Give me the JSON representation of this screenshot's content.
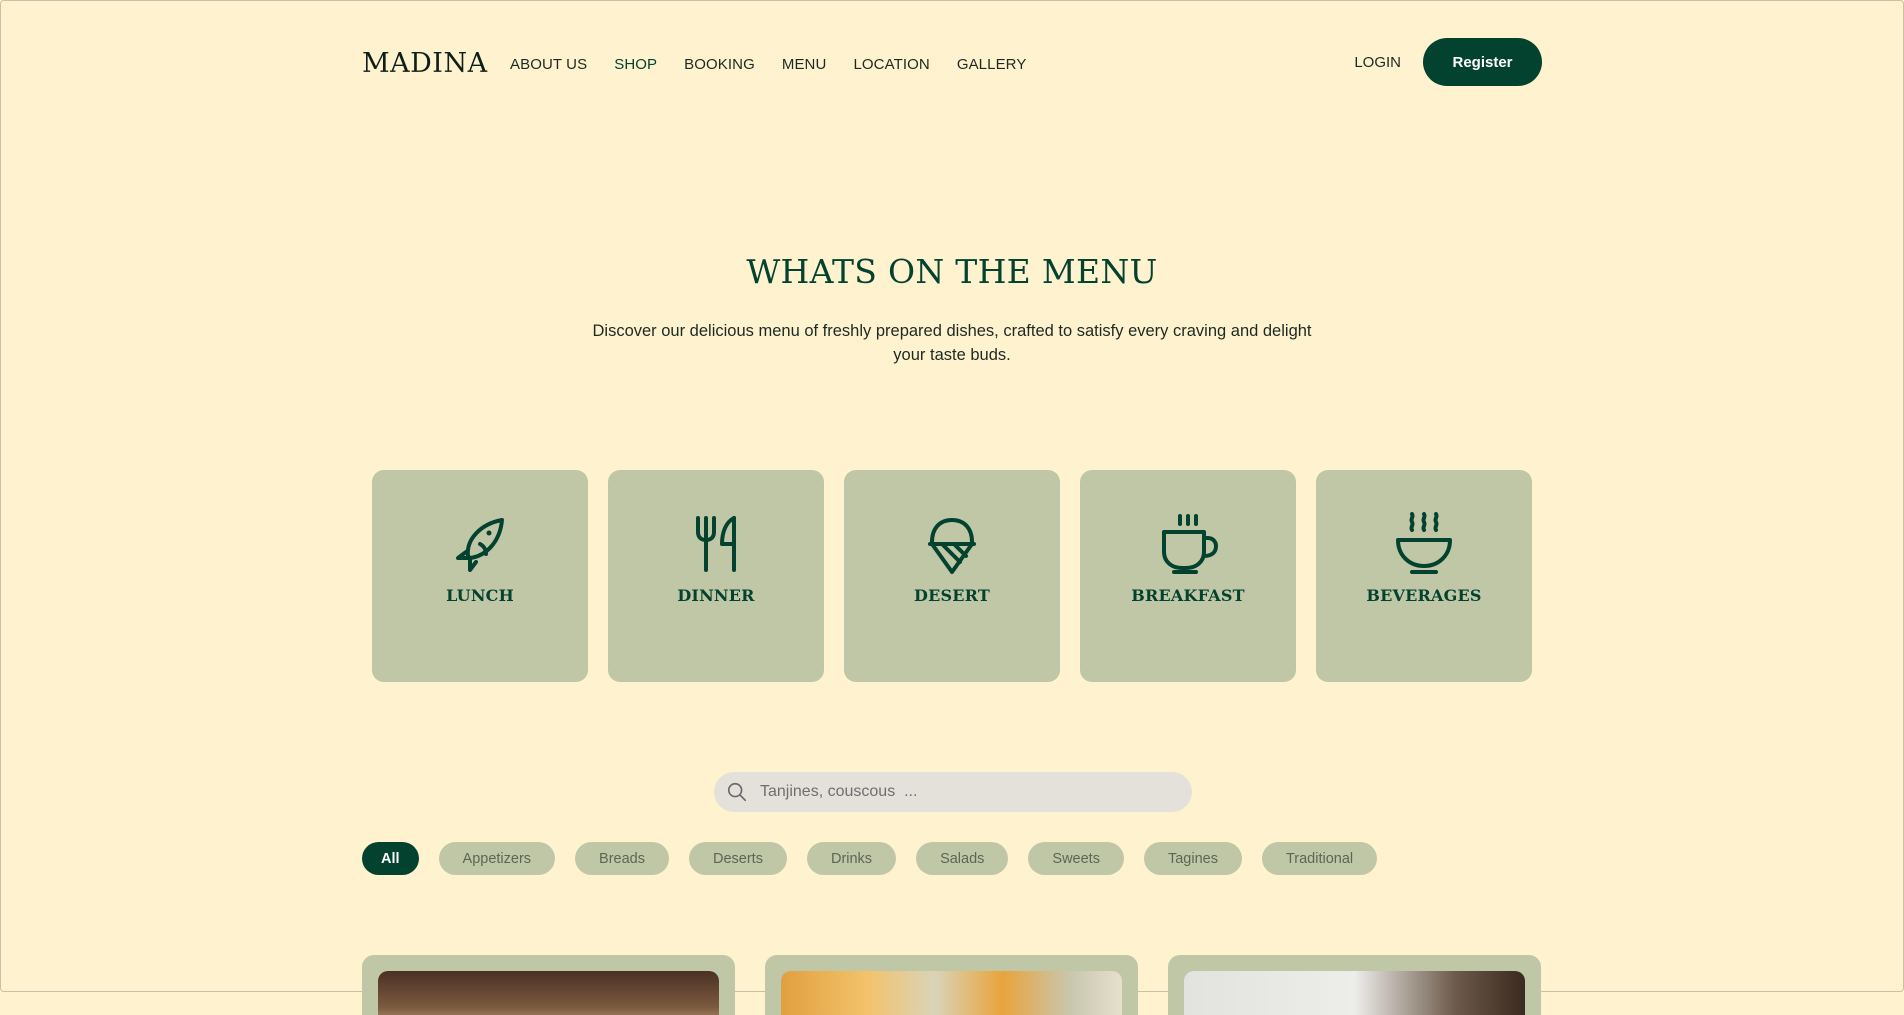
{
  "header": {
    "brand": "MADINA",
    "nav": [
      {
        "label": "ABOUT US",
        "active": false
      },
      {
        "label": "SHOP",
        "active": true
      },
      {
        "label": "BOOKING",
        "active": false
      },
      {
        "label": "MENU",
        "active": false
      },
      {
        "label": "LOCATION",
        "active": false
      },
      {
        "label": "GALLERY",
        "active": false
      }
    ],
    "login_label": "LOGIN",
    "register_label": "Register"
  },
  "hero": {
    "title": "WHATS ON THE MENU",
    "description": "Discover our delicious menu of freshly prepared dishes, crafted to satisfy every craving and delight your taste buds."
  },
  "categories": [
    {
      "label": "LUNCH",
      "icon": "fish-icon"
    },
    {
      "label": "DINNER",
      "icon": "fork-knife-icon"
    },
    {
      "label": "DESERT",
      "icon": "ice-cream-icon"
    },
    {
      "label": "BREAKFAST",
      "icon": "coffee-cup-icon"
    },
    {
      "label": "BEVERAGES",
      "icon": "steaming-bowl-icon"
    }
  ],
  "search": {
    "placeholder": "Tanjines, couscous  ...",
    "value": ""
  },
  "filters": [
    {
      "label": "All",
      "active": true
    },
    {
      "label": "Appetizers",
      "active": false
    },
    {
      "label": "Breads",
      "active": false
    },
    {
      "label": "Deserts",
      "active": false
    },
    {
      "label": "Drinks",
      "active": false
    },
    {
      "label": "Salads",
      "active": false
    },
    {
      "label": "Sweets",
      "active": false
    },
    {
      "label": "Tagines",
      "active": false
    },
    {
      "label": "Traditional",
      "active": false
    }
  ],
  "colors": {
    "background": "#FFF2CF",
    "brand_green": "#03422F",
    "card_sage": "#C0C7A7",
    "search_bg": "#E3E1DA"
  }
}
